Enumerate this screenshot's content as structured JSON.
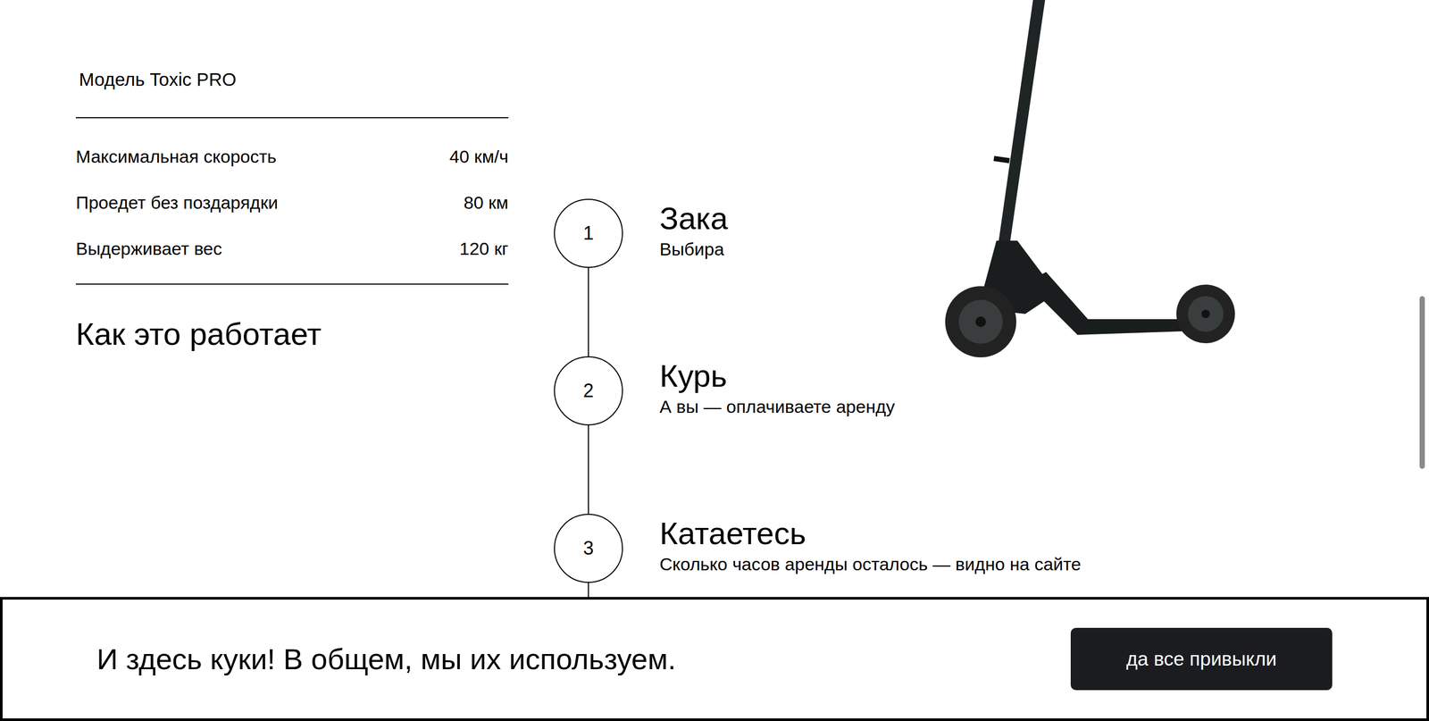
{
  "specs": {
    "title": "Модель Toxic PRO",
    "rows": [
      {
        "label": "Максимальная скорость",
        "value": "40 км/ч"
      },
      {
        "label": "Проедет без поздарядки",
        "value": "80 км"
      },
      {
        "label": "Выдерживает вес",
        "value": "120 кг"
      }
    ]
  },
  "how": {
    "title": "Как это работает",
    "steps": [
      {
        "number": "1",
        "title": "Зака",
        "text": "Выбира"
      },
      {
        "number": "2",
        "title": "Курь",
        "text": "А вы — оплачиваете аренду"
      },
      {
        "number": "3",
        "title": "Катаетесь",
        "text": "Сколько часов аренды осталось — видно на сайте"
      }
    ]
  },
  "cookie": {
    "text": "И здесь куки! В общем, мы их используем.",
    "button": "да все привыкли"
  }
}
